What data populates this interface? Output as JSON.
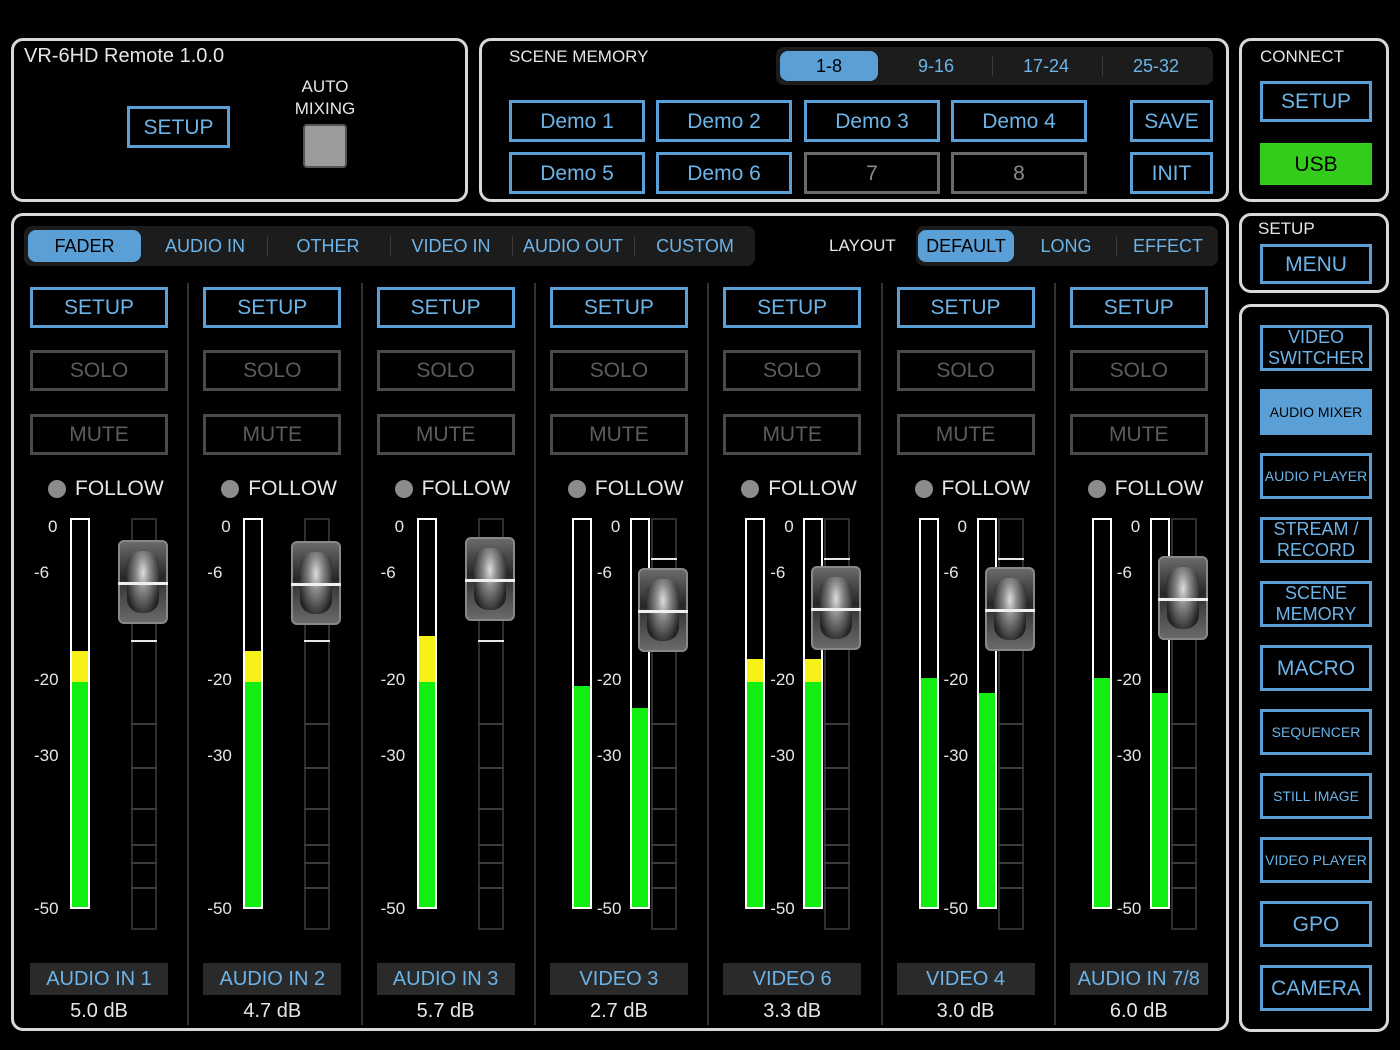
{
  "app": {
    "title": "VR-6HD Remote 1.0.0",
    "setup_label": "SETUP",
    "auto_mixing_label": "AUTO\nMIXING"
  },
  "scene_memory": {
    "title": "SCENE MEMORY",
    "pages": [
      "1-8",
      "9-16",
      "17-24",
      "25-32"
    ],
    "active_page": "1-8",
    "scenes": [
      "Demo 1",
      "Demo 2",
      "Demo 3",
      "Demo 4",
      "Demo 5",
      "Demo 6",
      "7",
      "8"
    ],
    "save_label": "SAVE",
    "init_label": "INIT"
  },
  "connect": {
    "title": "CONNECT",
    "setup_label": "SETUP",
    "usb_label": "USB"
  },
  "setup_menu": {
    "title": "SETUP",
    "menu_label": "MENU"
  },
  "side_nav": [
    {
      "label": "VIDEO\nSWITCHER",
      "active": false
    },
    {
      "label": "AUDIO MIXER",
      "active": true
    },
    {
      "label": "AUDIO PLAYER",
      "active": false
    },
    {
      "label": "STREAM /\nRECORD",
      "active": false
    },
    {
      "label": "SCENE\nMEMORY",
      "active": false
    },
    {
      "label": "MACRO",
      "active": false
    },
    {
      "label": "SEQUENCER",
      "active": false
    },
    {
      "label": "STILL IMAGE",
      "active": false
    },
    {
      "label": "VIDEO PLAYER",
      "active": false
    },
    {
      "label": "GPO",
      "active": false
    },
    {
      "label": "CAMERA",
      "active": false
    }
  ],
  "tabs": [
    "FADER",
    "AUDIO IN",
    "OTHER",
    "VIDEO IN",
    "AUDIO OUT",
    "CUSTOM"
  ],
  "active_tab": "FADER",
  "layout": {
    "label": "LAYOUT",
    "options": [
      "DEFAULT",
      "LONG",
      "EFFECT"
    ],
    "active": "DEFAULT"
  },
  "strip_labels": {
    "setup": "SETUP",
    "solo": "SOLO",
    "mute": "MUTE",
    "follow": "FOLLOW"
  },
  "scale_labels": [
    "0",
    "-6",
    "-20",
    "-30",
    "-50"
  ],
  "channels": [
    {
      "name": "AUDIO IN 1",
      "gain": "5.0 dB",
      "stereo": false,
      "meters": [
        -16
      ],
      "fader_db": 5.0
    },
    {
      "name": "AUDIO IN 2",
      "gain": "4.7 dB",
      "stereo": false,
      "meters": [
        -16
      ],
      "fader_db": 4.7
    },
    {
      "name": "AUDIO IN 3",
      "gain": "5.7 dB",
      "stereo": false,
      "meters": [
        -14
      ],
      "fader_db": 5.7
    },
    {
      "name": "VIDEO 3",
      "gain": "2.7 dB",
      "stereo": true,
      "meters": [
        -21,
        -24
      ],
      "fader_db": 2.7
    },
    {
      "name": "VIDEO 6",
      "gain": "3.3 dB",
      "stereo": true,
      "meters": [
        -17,
        -17
      ],
      "fader_db": 3.3
    },
    {
      "name": "VIDEO 4",
      "gain": "3.0 dB",
      "stereo": true,
      "meters": [
        -20,
        -22
      ],
      "fader_db": 3.0
    },
    {
      "name": "AUDIO IN 7/8",
      "gain": "6.0 dB",
      "stereo": true,
      "meters": [
        -20,
        -22
      ],
      "fader_db": 6.0
    }
  ],
  "colors": {
    "accent": "#5aa0d6",
    "usb": "#33cc1a",
    "meter_green": "#11ee11",
    "meter_yellow": "#f5f016"
  }
}
